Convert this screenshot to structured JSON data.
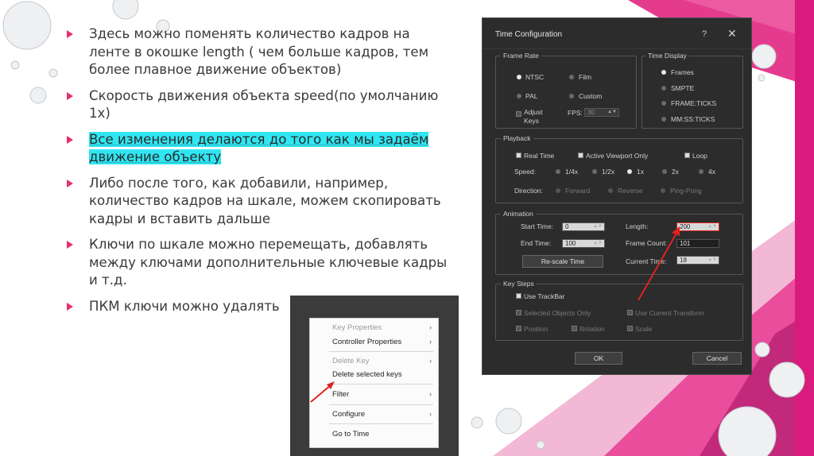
{
  "bullets": [
    {
      "text": "Здесь можно поменять количество кадров на ленте в окошке length ( чем больше кадров, тем более плавное движение объектов)",
      "highlighted": false
    },
    {
      "text": "Скорость движения объекта   speed(по умолчанию 1х)",
      "highlighted": false
    },
    {
      "text": "Все изменения делаются до того как мы задаём движение объекту ",
      "highlighted": true
    },
    {
      "text": "Либо после того, как добавили, например, количество кадров на шкале, можем скопировать кадры и вставить дальше",
      "highlighted": false
    },
    {
      "text": "Ключи по шкале можно перемещать, добавлять между ключами дополнительные ключевые кадры и т.д.",
      "highlighted": false
    },
    {
      "text": "ПКМ ключи можно удалять",
      "highlighted": false
    }
  ],
  "dialog": {
    "title": "Time Configuration",
    "help": "?",
    "close": "✕",
    "frame_rate": {
      "label": "Frame Rate",
      "ntsc": "NTSC",
      "film": "Film",
      "pal": "PAL",
      "custom": "Custom",
      "adjust": "Adjust",
      "keys": "Keys",
      "fps_label": "FPS:",
      "fps_value": "30"
    },
    "time_display": {
      "label": "Time Display",
      "frames": "Frames",
      "smpte": "SMPTE",
      "frame_ticks": "FRAME:TICKS",
      "mm_ss_ticks": "MM:SS:TICKS"
    },
    "playback": {
      "label": "Playback",
      "real_time": "Real Time",
      "active_viewport": "Active Viewport Only",
      "loop": "Loop",
      "speed_label": "Speed:",
      "speeds": [
        "1/4x",
        "1/2x",
        "1x",
        "2x",
        "4x"
      ],
      "direction_label": "Direction:",
      "forward": "Forward",
      "reverse": "Reverse",
      "ping_pong": "Ping-Pong"
    },
    "animation": {
      "label": "Animation",
      "start_time_label": "Start Time:",
      "start_time": "0",
      "end_time_label": "End Time:",
      "end_time": "100",
      "length_label": "Length:",
      "length": "200",
      "frame_count_label": "Frame Count:",
      "frame_count": "101",
      "current_time_label": "Current Time:",
      "current_time": "18",
      "rescale": "Re-scale Time"
    },
    "key_steps": {
      "label": "Key Steps",
      "use_trackbar": "Use TrackBar",
      "selected_only": "Selected Objects Only",
      "use_current": "Use Current Transform",
      "position": "Position",
      "rotation": "Rotation",
      "scale": "Scale"
    },
    "ok": "OK",
    "cancel": "Cancel"
  },
  "context_menu": {
    "key_properties": "Key Properties",
    "controller_properties": "Controller Properties",
    "delete_key": "Delete Key",
    "delete_selected": "Delete selected keys",
    "filter": "Filter",
    "configure": "Configure",
    "go_to_time": "Go to Time"
  },
  "colors": {
    "accent": "#e4306d",
    "highlight": "#2fe6f2",
    "arrow": "#e0221f"
  }
}
